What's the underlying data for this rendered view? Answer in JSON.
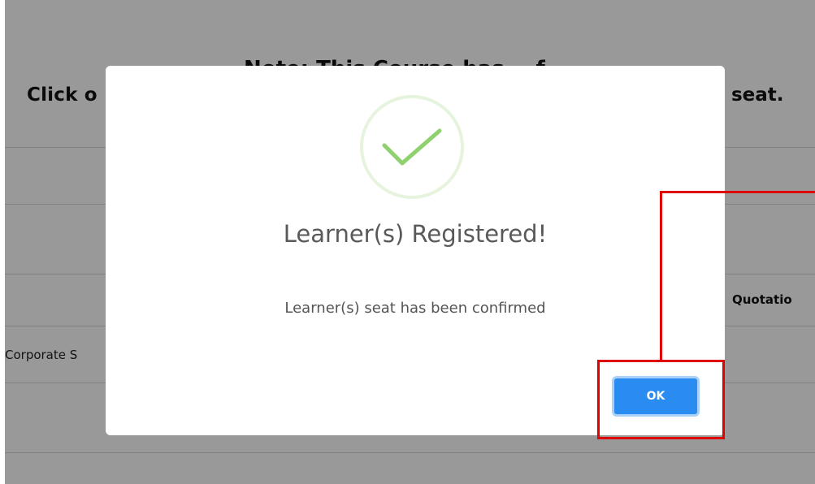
{
  "background": {
    "title_partial": "Note: This Course has ...f...",
    "instruction_left": "Click o",
    "instruction_right": "m seat.",
    "table": {
      "column_header_partial": "Quotatio",
      "row_cell_partial": "Corporate S"
    }
  },
  "dialog": {
    "title": "Learner(s) Registered!",
    "message": "Learner(s) seat has been confirmed",
    "ok_label": "OK",
    "icon": "success-check-icon"
  },
  "colors": {
    "ok_button": "#2a8cf0",
    "check": "#8fd16f",
    "annotation": "#e00000",
    "overlay": "rgba(0,0,0,0.40)"
  }
}
